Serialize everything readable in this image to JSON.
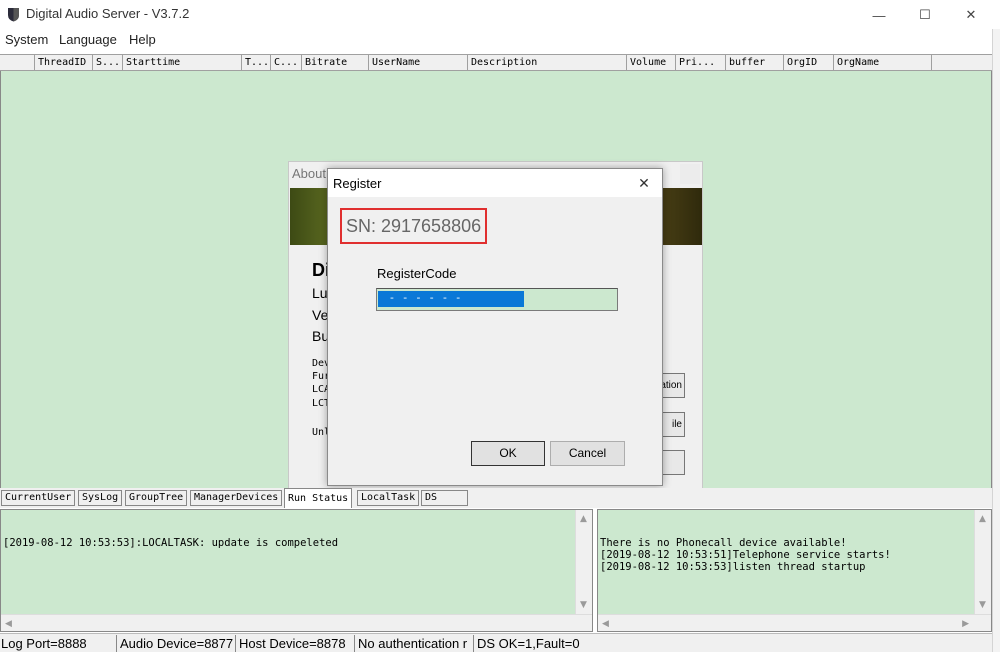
{
  "window": {
    "title": "Digital Audio Server - V3.7.2",
    "controls": {
      "minimize": "—",
      "maximize": "☐",
      "close": "✕"
    }
  },
  "menu": [
    "System",
    "Language",
    "Help"
  ],
  "list": {
    "columns": [
      "",
      "ThreadID",
      "S...",
      "Starttime",
      "T...",
      "C...",
      "Bitrate",
      "UserName",
      "Description",
      "Volume",
      "Pri...",
      "buffer",
      "OrgID",
      "OrgName",
      ""
    ]
  },
  "tabs": [
    "CurrentUser",
    "SysLog",
    "GroupTree",
    "ManagerDevices",
    "Run Status",
    "LocalTask",
    "DS"
  ],
  "active_tab": "Run Status",
  "log_left": "[2019-08-12 10:53:53]:LOCALTASK: update is compeleted",
  "log_right": "There is no Phonecall device available!\n[2019-08-12 10:53:51]Telephone service starts!\n[2019-08-12 10:53:53]listen thread startup",
  "status": [
    "Log Port=8888",
    "Audio Device=8877",
    "Host Device=8878",
    "No authentication r",
    "DS OK=1,Fault=0"
  ],
  "about": {
    "title": "About",
    "heading": "Di",
    "lines": [
      "Lu",
      "Ve",
      "Bu"
    ],
    "small_lines": [
      "Dev",
      "Fur",
      "LCA",
      "LCT",
      "Unl"
    ],
    "buttons": [
      "ation",
      "ile",
      ""
    ]
  },
  "register": {
    "title": "Register",
    "close": "✕",
    "sn": "SN: 2917658806",
    "label": "RegisterCode",
    "code": " - - - - - -",
    "ok": "OK",
    "cancel": "Cancel"
  },
  "colors": {
    "content_bg": "#cce8cf",
    "selection": "#0a78d7",
    "highlight_border": "#e02f2f"
  }
}
